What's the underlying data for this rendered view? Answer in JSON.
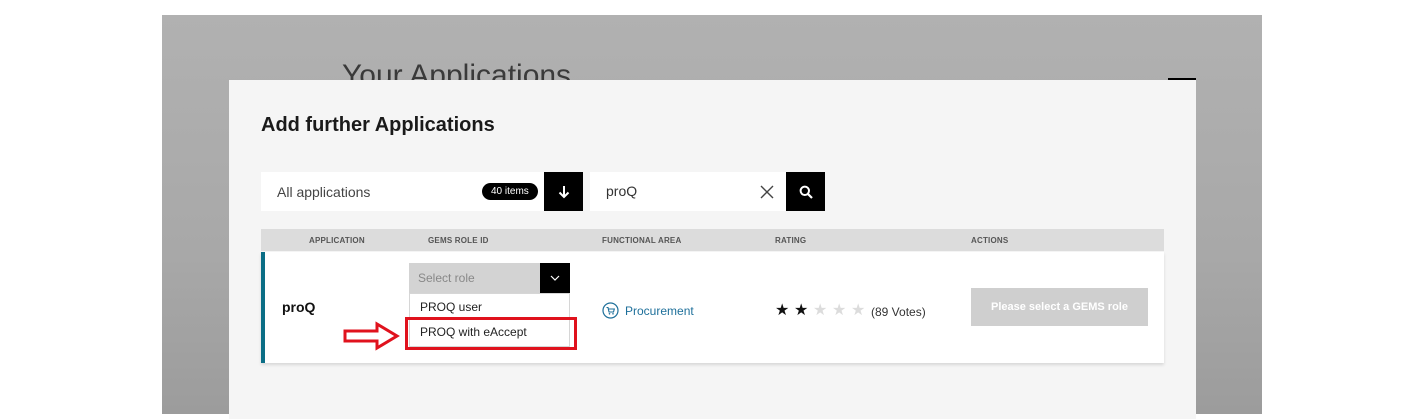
{
  "background_page": {
    "title": "Your Applications"
  },
  "modal": {
    "title": "Add further Applications",
    "close_icon": "close-icon"
  },
  "filter": {
    "label": "All applications",
    "count_badge": "40 items",
    "button_icon": "arrow-down-icon"
  },
  "search": {
    "value": "proQ",
    "clear_icon": "close-icon",
    "button_icon": "search-icon"
  },
  "table": {
    "headers": [
      "APPLICATION",
      "GEMS ROLE ID",
      "FUNCTIONAL AREA",
      "RATING",
      "ACTIONS"
    ],
    "rows": [
      {
        "application": "proQ",
        "role_placeholder": "Select role",
        "role_options": [
          "PROQ user",
          "PROQ with eAccept"
        ],
        "highlighted_option": "PROQ with eAccept",
        "functional_area": "Procurement",
        "functional_area_icon": "cart-icon",
        "rating": {
          "value": 2,
          "max": 5
        },
        "votes": "(89 Votes)",
        "action_label": "Please select a GEMS role"
      }
    ]
  },
  "colors": {
    "accent": "#0b6e86",
    "link": "#1d6f9a",
    "annotation": "#e0121d",
    "disabled_button": "#cfcfcf"
  }
}
